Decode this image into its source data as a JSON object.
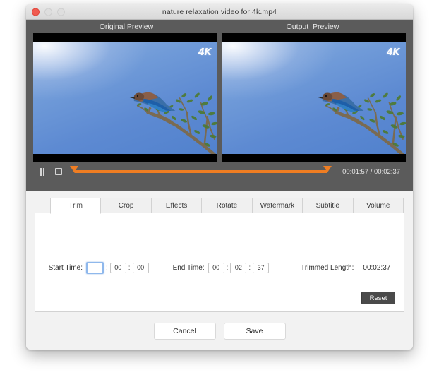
{
  "window": {
    "title": "nature relaxation video for 4k.mp4",
    "traffic_lights": [
      {
        "name": "close",
        "color": "#f05b50"
      },
      {
        "name": "minimize",
        "color": "#dedede"
      },
      {
        "name": "maximize",
        "color": "#dedede"
      }
    ]
  },
  "previews": {
    "original_label": "Original Preview",
    "output_label": "Output  Preview",
    "watermark": "4K",
    "scene": "bird perched on a branch against blue sky"
  },
  "transport": {
    "pause_icon": "pause-icon",
    "stop_icon": "stop-icon",
    "current_time": "00:01:57",
    "total_time": "00:02:37",
    "time_display": "00:01:57 / 00:02:37",
    "progress_percent": 75,
    "trim_start_percent": 0,
    "trim_end_percent": 100,
    "accent_color": "#ef7d22"
  },
  "tabs": [
    {
      "label": "Trim",
      "active": true
    },
    {
      "label": "Crop",
      "active": false
    },
    {
      "label": "Effects",
      "active": false
    },
    {
      "label": "Rotate",
      "active": false
    },
    {
      "label": "Watermark",
      "active": false
    },
    {
      "label": "Subtitle",
      "active": false
    },
    {
      "label": "Volume",
      "active": false
    }
  ],
  "trim": {
    "start_time_label": "Start Time:",
    "start_hours": "",
    "start_minutes": "00",
    "start_seconds": "00",
    "end_time_label": "End Time:",
    "end_hours": "00",
    "end_minutes": "02",
    "end_seconds": "37",
    "separator": ":",
    "trimmed_length_label": "Trimmed Length:",
    "trimmed_length_value": "00:02:37",
    "reset_label": "Reset"
  },
  "footer": {
    "cancel_label": "Cancel",
    "save_label": "Save"
  }
}
